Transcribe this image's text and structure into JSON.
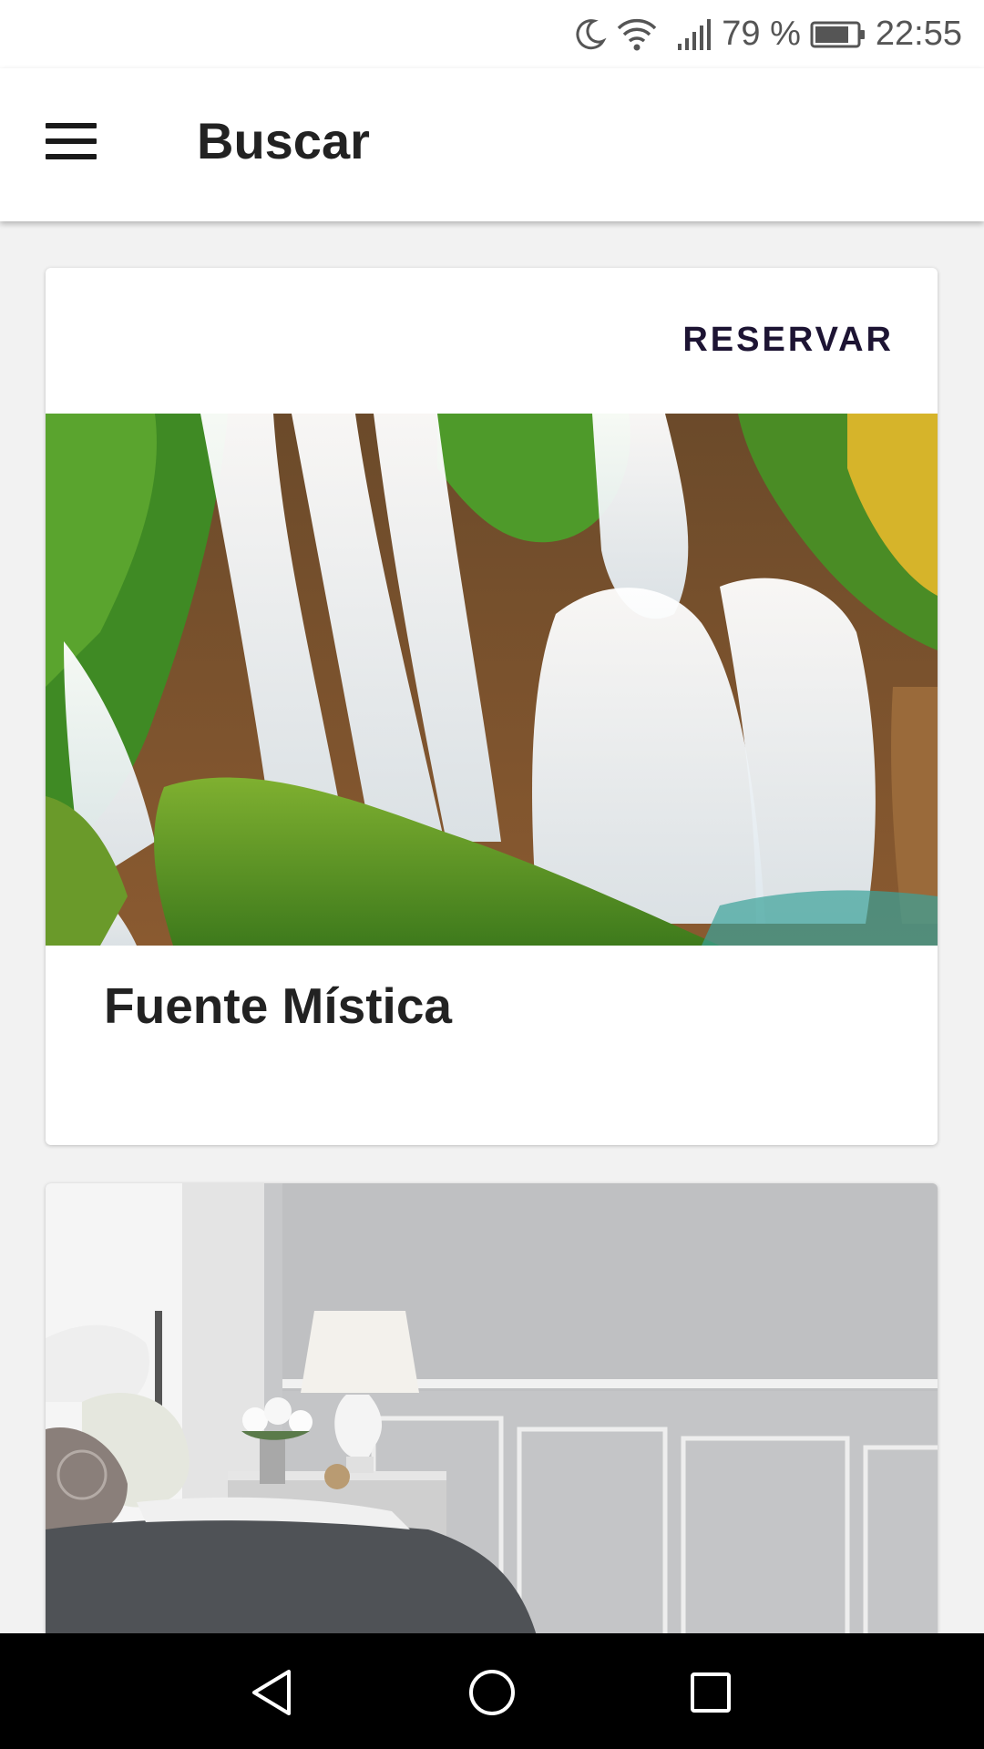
{
  "status_bar": {
    "battery_percent": "79 %",
    "time": "22:55",
    "icons": [
      "moon-icon",
      "wifi-icon",
      "signal-icon",
      "battery-icon"
    ]
  },
  "app_bar": {
    "title": "Buscar",
    "menu_icon": "hamburger-menu-icon"
  },
  "cards": [
    {
      "action_label": "RESERVAR",
      "image": "waterfall-photo",
      "title": "Fuente Mística"
    },
    {
      "image": "bedroom-photo"
    }
  ],
  "nav_bar": {
    "icons": [
      "back-icon",
      "home-icon",
      "recent-apps-icon"
    ]
  },
  "colors": {
    "accent": "#1d1433",
    "background": "#f2f2f2",
    "card": "#ffffff"
  }
}
